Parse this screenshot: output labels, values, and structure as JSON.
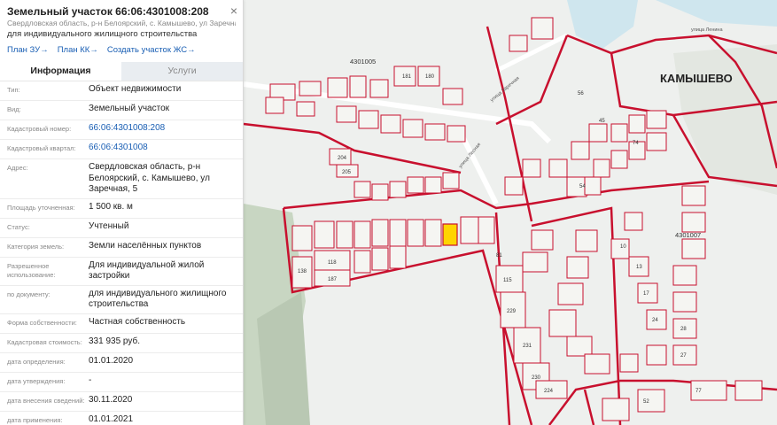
{
  "panel": {
    "title": "Земельный участок 66:06:4301008:208",
    "address_short": "Свердловская область, р-н Белоярский, с. Камышево, ул Заречная, 5",
    "purpose": "для индивидуального жилищного строительства",
    "links": [
      "План ЗУ→",
      "План КК→",
      "Создать участок ЖС→"
    ],
    "tabs": [
      "Информация",
      "Услуги"
    ],
    "rows": [
      {
        "label": "Тип:",
        "value": "Объект недвижимости"
      },
      {
        "label": "Вид:",
        "value": "Земельный участок"
      },
      {
        "label": "Кадастровый номер:",
        "value": "66:06:4301008:208"
      },
      {
        "label": "Кадастровый квартал:",
        "value": "66:06:4301008"
      },
      {
        "label": "Адрес:",
        "value": "Свердловская область, р-н Белоярский, с. Камышево, ул Заречная, 5"
      },
      {
        "label": "Площадь уточненная:",
        "value": "1 500 кв. м"
      },
      {
        "label": "Статус:",
        "value": "Учтенный"
      },
      {
        "label": "Категория земель:",
        "value": "Земли населённых пунктов"
      },
      {
        "label": "Разрешенное использование:",
        "value": "Для индивидуальной жилой застройки"
      },
      {
        "label": "по документу:",
        "value": "для индивидуального жилищного строительства"
      },
      {
        "label": "Форма собственности:",
        "value": "Частная собственность"
      },
      {
        "label": "Кадастровая стоимость:",
        "value": "331 935 руб."
      },
      {
        "label": "дата определения:",
        "value": "01.01.2020"
      },
      {
        "label": "дата утверждения:",
        "value": "-"
      },
      {
        "label": "дата внесения сведений:",
        "value": "30.11.2020"
      },
      {
        "label": "дата применения:",
        "value": "01.01.2021"
      }
    ]
  },
  "map": {
    "village_name": "КАМЫШЕВО",
    "quarter_labels": [
      "4301005",
      "4301007"
    ],
    "street_labels": [
      "улица Заречная",
      "улица Лесная",
      "улица Ленина"
    ],
    "parcel_numbers": [
      "181",
      "180",
      "56",
      "45",
      "74",
      "54",
      "204",
      "205",
      "115",
      "229",
      "231",
      "230",
      "224",
      "138",
      "118",
      "187",
      "81",
      "52",
      "77",
      "28",
      "27",
      "10",
      "13",
      "17",
      "24"
    ],
    "colors": {
      "boundary": "#c8102e",
      "highlight": "#ffd400",
      "water": "#cfe6ee",
      "forest": "#c8d6c2"
    }
  }
}
